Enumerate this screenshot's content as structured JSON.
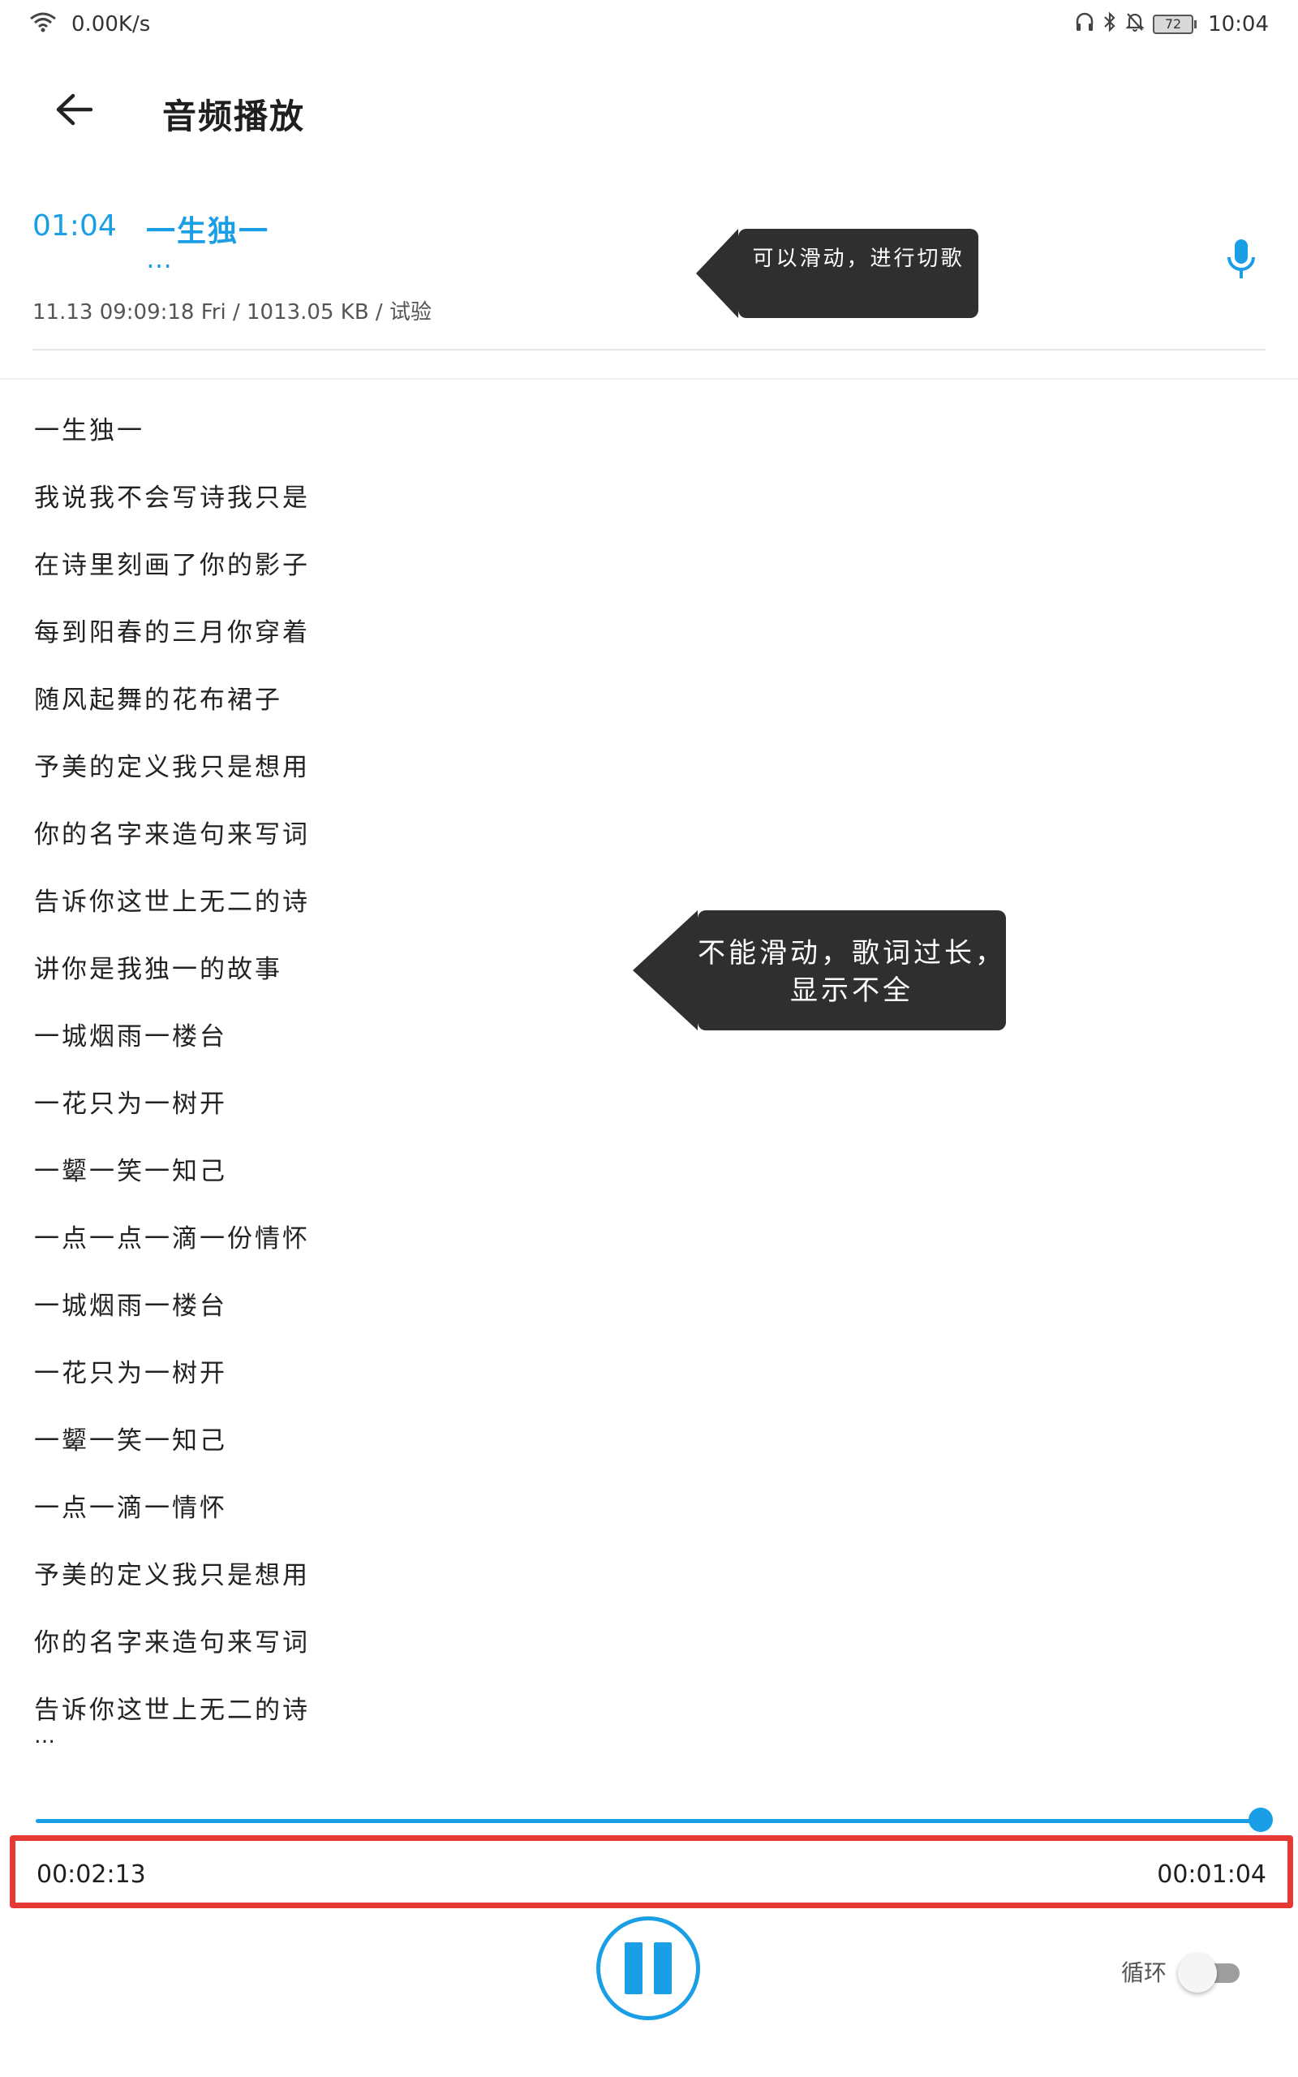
{
  "status_bar": {
    "network_speed": "0.00K/s",
    "battery_level": "72",
    "time": "10:04"
  },
  "header": {
    "title": "音频播放"
  },
  "track": {
    "time": "01:04",
    "title": "一生独一",
    "title_ellipsis": "…",
    "meta": "11.13 09:09:18 Fri / 1013.05 KB / 试验"
  },
  "annotations": {
    "swipe_hint": "可以滑动，进行切歌",
    "lyrics_hint": "不能滑动，歌词过长，显示不全"
  },
  "lyrics": [
    "一生独一",
    "我说我不会写诗我只是",
    "在诗里刻画了你的影子",
    "每到阳春的三月你穿着",
    "随风起舞的花布裙子",
    "予美的定义我只是想用",
    "你的名字来造句来写词",
    "告诉你这世上无二的诗",
    "讲你是我独一的故事",
    "一城烟雨一楼台",
    "一花只为一树开",
    "一颦一笑一知己",
    "一点一点一滴一份情怀",
    "一城烟雨一楼台",
    "一花只为一树开",
    "一颦一笑一知己",
    "一点一滴一情怀",
    "予美的定义我只是想用",
    "你的名字来造句来写词",
    "告诉你这世上无二的诗"
  ],
  "lyrics_ellipsis": "…",
  "player": {
    "progress": 1.0,
    "current_time": "00:02:13",
    "total_time": "00:01:04",
    "loop_label": "循环",
    "loop_enabled": false
  },
  "colors": {
    "accent": "#1a9ee6",
    "callout_bg": "#2f2f2f",
    "highlight_border": "#e53935"
  },
  "icons": {
    "wifi": "wifi-icon",
    "back": "arrow-left-icon",
    "mic": "microphone-icon",
    "pause": "pause-icon"
  }
}
